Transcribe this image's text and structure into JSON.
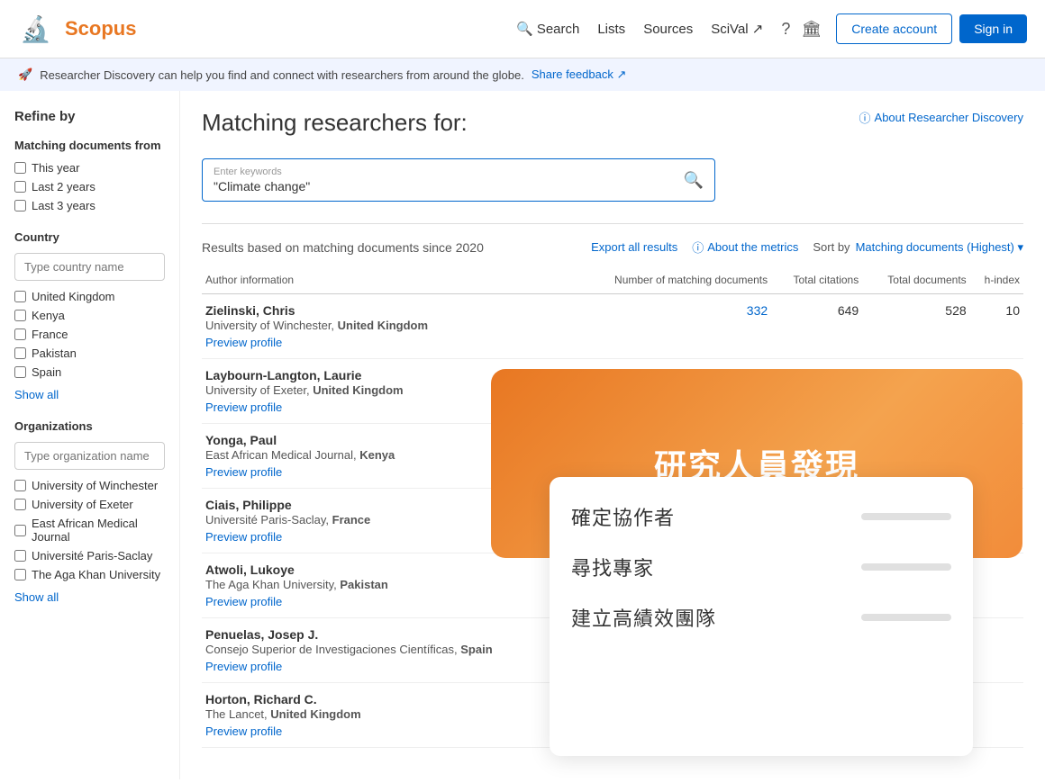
{
  "header": {
    "logo_text": "Scopus",
    "nav": {
      "search": "Search",
      "lists": "Lists",
      "sources": "Sources",
      "scival": "SciVal ↗"
    },
    "create_account": "Create account",
    "sign_in": "Sign in"
  },
  "banner": {
    "text": "Researcher Discovery can help you find and connect with researchers from around the globe.",
    "feedback": "Share feedback ↗"
  },
  "sidebar": {
    "refine_title": "Refine by",
    "matching_docs_from": "Matching documents from",
    "checkboxes_time": [
      {
        "label": "This year"
      },
      {
        "label": "Last 2 years"
      },
      {
        "label": "Last 3 years"
      }
    ],
    "country_title": "Country",
    "country_placeholder": "Type country name",
    "countries": [
      {
        "label": "United Kingdom"
      },
      {
        "label": "Kenya"
      },
      {
        "label": "France"
      },
      {
        "label": "Pakistan"
      },
      {
        "label": "Spain"
      }
    ],
    "show_all": "Show all",
    "organizations_title": "Organizations",
    "org_placeholder": "Type organization name",
    "organizations": [
      {
        "label": "University of Winchester"
      },
      {
        "label": "University of Exeter"
      },
      {
        "label": "East African Medical Journal"
      },
      {
        "label": "Université Paris-Saclay"
      },
      {
        "label": "The Aga Khan University"
      }
    ],
    "show_all_orgs": "Show all"
  },
  "main": {
    "title": "Matching researchers for:",
    "about_link": "About Researcher Discovery",
    "search_label": "Enter keywords",
    "search_value": "\"Climate change\"",
    "results_subtitle": "Results based on matching documents since 2020",
    "export": "Export all results",
    "metrics": "About the metrics",
    "sort_label": "Sort by",
    "sort_value": "Matching documents (Highest) ▾",
    "table": {
      "headers": {
        "author": "Author information",
        "matching": "Number of matching documents",
        "citations": "Total citations",
        "documents": "Total documents",
        "hindex": "h-index"
      },
      "rows": [
        {
          "name": "Zielinski, Chris",
          "affiliation": "University of Winchester, ",
          "country": "United Kingdom",
          "matching": "332",
          "citations": "649",
          "documents": "528",
          "hindex": "10",
          "preview": "Preview profile"
        },
        {
          "name": "Laybourn-Langton, Laurie",
          "affiliation": "University of Exeter, ",
          "country": "United Kingdom",
          "matching": "",
          "citations": "",
          "documents": "",
          "hindex": "",
          "preview": "Preview profile"
        },
        {
          "name": "Yonga, Paul",
          "affiliation": "East African Medical Journal, ",
          "country": "Kenya",
          "matching": "",
          "citations": "",
          "documents": "",
          "hindex": "",
          "preview": "Preview profile"
        },
        {
          "name": "Ciais, Philippe",
          "affiliation": "Université Paris-Saclay, ",
          "country": "France",
          "matching": "",
          "citations": "",
          "documents": "",
          "hindex": "",
          "preview": "Preview profile"
        },
        {
          "name": "Atwoli, Lukoye",
          "affiliation": "The Aga Khan University, ",
          "country": "Pakistan",
          "matching": "",
          "citations": "",
          "documents": "",
          "hindex": "",
          "preview": "Preview profile"
        },
        {
          "name": "Penuelas, Josep J.",
          "affiliation": "Consejo Superior de Investigaciones Científicas, ",
          "country": "Spain",
          "matching": "",
          "citations": "",
          "documents": "",
          "hindex": "",
          "preview": "Preview profile"
        },
        {
          "name": "Horton, Richard C.",
          "affiliation": "The Lancet, ",
          "country": "United Kingdom",
          "matching": "",
          "citations": "",
          "documents": "",
          "hindex": "",
          "preview": "Preview profile"
        }
      ]
    }
  },
  "overlay": {
    "title": "研究人員發現",
    "items": [
      {
        "label": "確定協作者"
      },
      {
        "label": "尋找專家"
      },
      {
        "label": "建立高績效團隊"
      }
    ]
  }
}
